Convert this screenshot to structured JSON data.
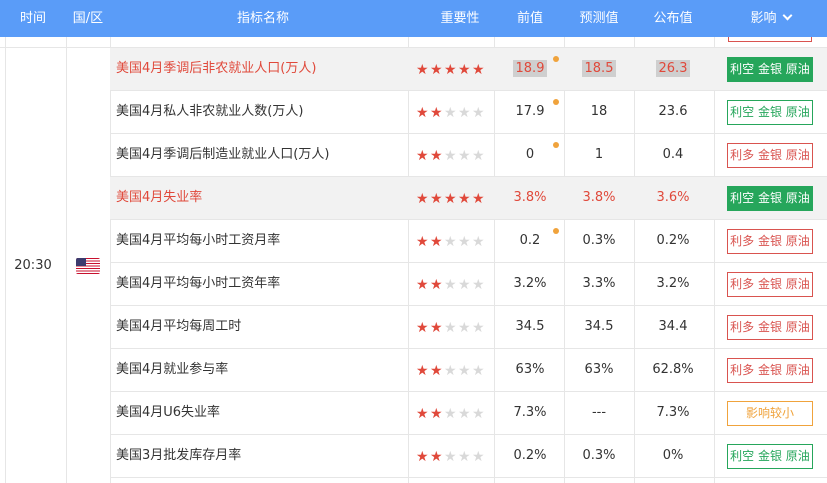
{
  "header": {
    "time": "时间",
    "country": "国/区",
    "indicator": "指标名称",
    "importance": "重要性",
    "previous": "前值",
    "forecast": "预测值",
    "actual": "公布值",
    "impact": "影响"
  },
  "group": {
    "time": "20:30",
    "country_icon": "us-flag-icon"
  },
  "colors": {
    "header_bg": "#5a9cf8",
    "star_on": "#e0493b",
    "star_off": "#d9d9d9",
    "bearish_green": "#26a65b",
    "bullish_red": "#d9534f",
    "neutral_orange": "#f0a33c",
    "highlight_text": "#e0493b"
  },
  "rows": [
    {
      "name": "美国4月季调后非农就业人口(万人)",
      "stars": 5,
      "previous": "18.9",
      "forecast": "18.5",
      "actual": "26.3",
      "impact": "利空 金银 原油",
      "impact_type": "bear-solid",
      "highlight": true,
      "red_text": true,
      "grey_values": true,
      "dot": true
    },
    {
      "name": "美国4月私人非农就业人数(万人)",
      "stars": 2,
      "previous": "17.9",
      "forecast": "18",
      "actual": "23.6",
      "impact": "利空 金银 原油",
      "impact_type": "bear",
      "highlight": false,
      "red_text": false,
      "grey_values": false,
      "dot": true
    },
    {
      "name": "美国4月季调后制造业就业人口(万人)",
      "stars": 2,
      "previous": "0",
      "forecast": "1",
      "actual": "0.4",
      "impact": "利多 金银 原油",
      "impact_type": "bull",
      "highlight": false,
      "red_text": false,
      "grey_values": false,
      "dot": true
    },
    {
      "name": "美国4月失业率",
      "stars": 5,
      "previous": "3.8%",
      "forecast": "3.8%",
      "actual": "3.6%",
      "impact": "利空 金银 原油",
      "impact_type": "bear-solid",
      "highlight": true,
      "red_text": true,
      "grey_values": false,
      "dot": false
    },
    {
      "name": "美国4月平均每小时工资月率",
      "stars": 2,
      "previous": "0.2",
      "forecast": "0.3%",
      "actual": "0.2%",
      "impact": "利多 金银 原油",
      "impact_type": "bull",
      "highlight": false,
      "red_text": false,
      "grey_values": false,
      "dot": true
    },
    {
      "name": "美国4月平均每小时工资年率",
      "stars": 2,
      "previous": "3.2%",
      "forecast": "3.3%",
      "actual": "3.2%",
      "impact": "利多 金银 原油",
      "impact_type": "bull",
      "highlight": false,
      "red_text": false,
      "grey_values": false,
      "dot": false
    },
    {
      "name": "美国4月平均每周工时",
      "stars": 2,
      "previous": "34.5",
      "forecast": "34.5",
      "actual": "34.4",
      "impact": "利多 金银 原油",
      "impact_type": "bull",
      "highlight": false,
      "red_text": false,
      "grey_values": false,
      "dot": false
    },
    {
      "name": "美国4月就业参与率",
      "stars": 2,
      "previous": "63%",
      "forecast": "63%",
      "actual": "62.8%",
      "impact": "利多 金银 原油",
      "impact_type": "bull",
      "highlight": false,
      "red_text": false,
      "grey_values": false,
      "dot": false
    },
    {
      "name": "美国4月U6失业率",
      "stars": 2,
      "previous": "7.3%",
      "forecast": "---",
      "actual": "7.3%",
      "impact": "影响较小",
      "impact_type": "neutral",
      "highlight": false,
      "red_text": false,
      "grey_values": false,
      "dot": false
    },
    {
      "name": "美国3月批发库存月率",
      "stars": 2,
      "previous": "0.2%",
      "forecast": "0.3%",
      "actual": "0%",
      "impact": "利空 金银 原油",
      "impact_type": "bear",
      "highlight": false,
      "red_text": false,
      "grey_values": false,
      "dot": false
    }
  ]
}
